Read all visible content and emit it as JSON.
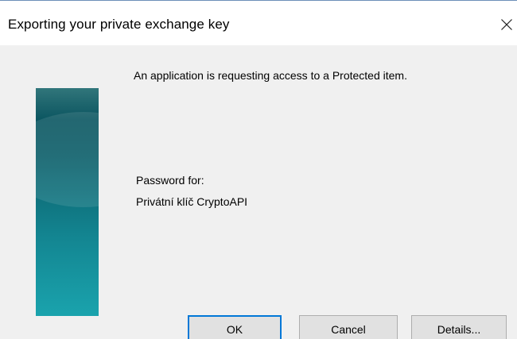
{
  "window": {
    "title": "Exporting your private exchange key",
    "close_icon": "close-icon"
  },
  "banner": {
    "icon": "security-banner-graphic",
    "colors": [
      "#0b4f5a",
      "#138591",
      "#1aa3ad"
    ]
  },
  "content": {
    "message": "An application is requesting access to a Protected item.",
    "password_label": "Password for:",
    "protected_item": "Privátní klíč CryptoAPI"
  },
  "buttons": {
    "ok": "OK",
    "cancel": "Cancel",
    "details": "Details..."
  },
  "colors": {
    "dialog_bg": "#f0f0f0",
    "titlebar_bg": "#ffffff",
    "default_button_border": "#0078d7"
  }
}
